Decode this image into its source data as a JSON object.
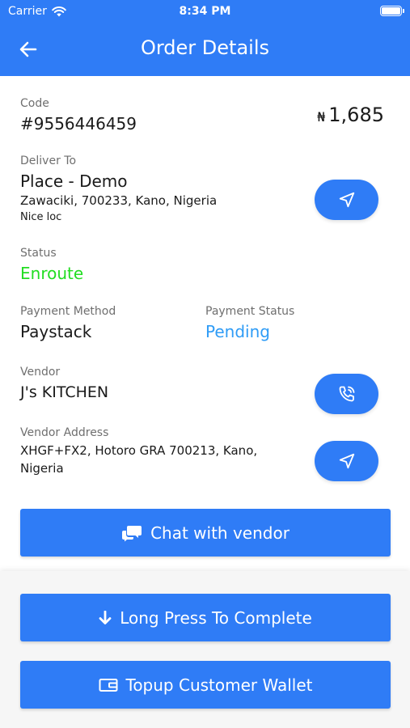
{
  "status_bar": {
    "carrier": "Carrier",
    "time": "8:34 PM"
  },
  "header": {
    "title": "Order Details",
    "back_icon": "arrow-left-icon"
  },
  "order": {
    "code_label": "Code",
    "code": "#9556446459",
    "currency_symbol": "₦",
    "amount": "1,685"
  },
  "deliver": {
    "label": "Deliver To",
    "name": "Place - Demo",
    "address": "Zawaciki, 700233, Kano, Nigeria",
    "note": "Nice loc",
    "icon": "navigation-arrow-icon"
  },
  "status": {
    "label": "Status",
    "value": "Enroute",
    "color": "#22dd22"
  },
  "payment": {
    "method_label": "Payment Method",
    "method": "Paystack",
    "status_label": "Payment Status",
    "status": "Pending",
    "status_color": "#2f9cf6"
  },
  "vendor": {
    "label": "Vendor",
    "name": "J's KITCHEN",
    "call_icon": "phone-call-icon",
    "address_label": "Vendor Address",
    "address_line1": "XHGF+FX2, Hotoro GRA 700213, Kano,",
    "address_line2": "Nigeria",
    "nav_icon": "navigation-arrow-icon"
  },
  "actions": {
    "chat_label": "Chat with vendor",
    "chat_icon": "chat-bubbles-icon",
    "complete_label": "Long Press To Complete",
    "complete_icon": "arrow-down-icon",
    "topup_label": "Topup Customer Wallet",
    "topup_icon": "wallet-icon"
  },
  "colors": {
    "primary": "#2f7cf6",
    "header_text": "#ffffff"
  }
}
